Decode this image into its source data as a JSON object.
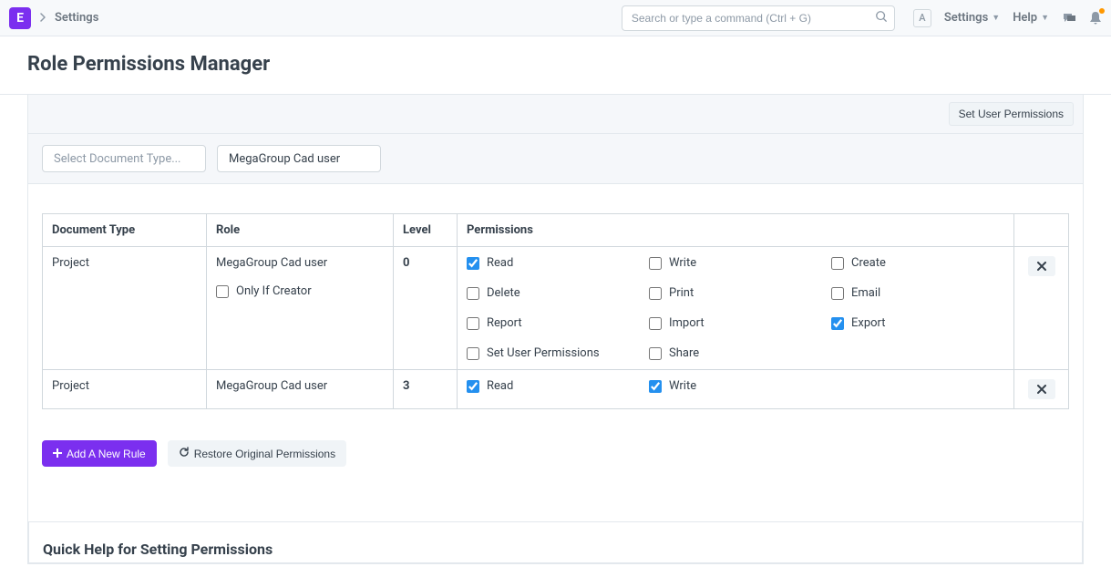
{
  "navbar": {
    "logo": "E",
    "breadcrumb": "Settings",
    "search_placeholder": "Search or type a command (Ctrl + G)",
    "avatar_letter": "A",
    "settings_label": "Settings",
    "help_label": "Help"
  },
  "page": {
    "title": "Role Permissions Manager",
    "set_user_perms": "Set User Permissions",
    "filter_doctype_placeholder": "Select Document Type...",
    "filter_role": "MegaGroup Cad user"
  },
  "table": {
    "headers": {
      "doctype": "Document Type",
      "role": "Role",
      "level": "Level",
      "permissions": "Permissions"
    },
    "rows": [
      {
        "doctype": "Project",
        "role": "MegaGroup Cad user",
        "only_if_creator": "Only If Creator",
        "level": "0",
        "perms": [
          {
            "label": "Read",
            "checked": true
          },
          {
            "label": "Write",
            "checked": false
          },
          {
            "label": "Create",
            "checked": false
          },
          {
            "label": "Delete",
            "checked": false
          },
          {
            "label": "Print",
            "checked": false
          },
          {
            "label": "Email",
            "checked": false
          },
          {
            "label": "Report",
            "checked": false
          },
          {
            "label": "Import",
            "checked": false
          },
          {
            "label": "Export",
            "checked": true
          },
          {
            "label": "Set User Permissions",
            "checked": false
          },
          {
            "label": "Share",
            "checked": false
          }
        ]
      },
      {
        "doctype": "Project",
        "role": "MegaGroup Cad user",
        "level": "3",
        "perms": [
          {
            "label": "Read",
            "checked": true
          },
          {
            "label": "Write",
            "checked": true
          }
        ]
      }
    ]
  },
  "actions": {
    "add_rule": "Add A New Rule",
    "restore": "Restore Original Permissions"
  },
  "help": {
    "title": "Quick Help for Setting Permissions"
  }
}
